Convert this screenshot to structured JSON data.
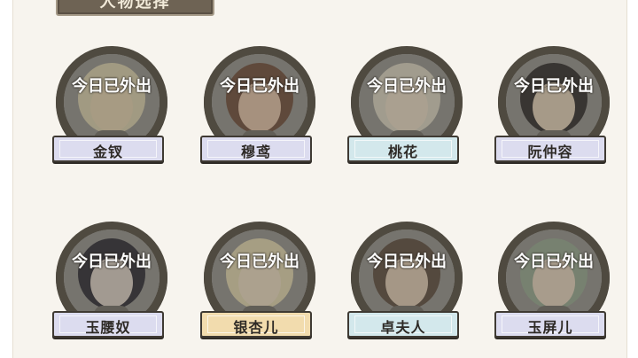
{
  "panel": {
    "title": "人物选择"
  },
  "status_text": "今日已外出",
  "characters": [
    {
      "name": "金钗",
      "plate": "lavender",
      "hair": "#cfc7a6",
      "skin": "#d9c8a8"
    },
    {
      "name": "穆鸢",
      "plate": "lavender",
      "hair": "#6b4a3a",
      "skin": "#d8b8a0"
    },
    {
      "name": "桃花",
      "plate": "lightblue",
      "hair": "#cfcab8",
      "skin": "#ded0bc"
    },
    {
      "name": "阮仲容",
      "plate": "lavender",
      "hair": "#2f2b2b",
      "skin": "#d8c6b0"
    },
    {
      "name": "玉腰奴",
      "plate": "lavender",
      "hair": "#2b2a33",
      "skin": "#d2c6bd"
    },
    {
      "name": "银杏儿",
      "plate": "gold",
      "hair": "#d7cda8",
      "skin": "#e0d2b8"
    },
    {
      "name": "卓夫人",
      "plate": "lightblue",
      "hair": "#5a4a3e",
      "skin": "#d6c2ad"
    },
    {
      "name": "玉屏儿",
      "plate": "lavender",
      "hair": "#8fa08a",
      "skin": "#dbcab5"
    }
  ]
}
